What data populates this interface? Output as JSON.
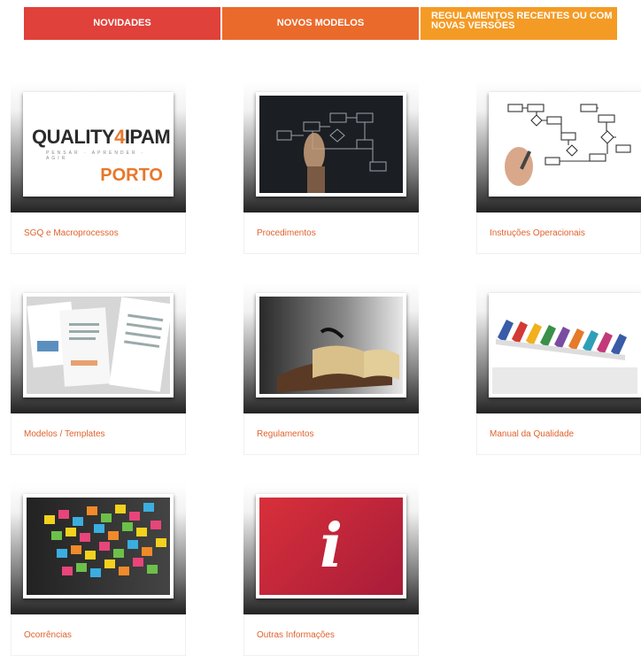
{
  "nav": {
    "tabs": [
      {
        "label": "NOVIDADES"
      },
      {
        "label": "NOVOS MODELOS"
      },
      {
        "label": "REGULAMENTOS RECENTES OU COM NOVAS VERSÕES"
      }
    ]
  },
  "cards": [
    {
      "label": "SGQ e Macroprocessos",
      "image_text": {
        "brand_left": "QUALITY",
        "brand_num": "4",
        "brand_right": "IPAM",
        "tagline": "PENSAR · APRENDER · AGIR",
        "city": "PORTO"
      }
    },
    {
      "label": "Procedimentos"
    },
    {
      "label": "Instruções Operacionais"
    },
    {
      "label": "Modelos / Templates"
    },
    {
      "label": "Regulamentos"
    },
    {
      "label": "Manual da Qualidade"
    },
    {
      "label": "Ocorrências"
    },
    {
      "label": "Outras Informações",
      "image_text": {
        "glyph": "i"
      }
    }
  ],
  "colors": {
    "tab1": "#e0413a",
    "tab2": "#ea6a2c",
    "tab3": "#f49b25",
    "caption": "#e0622c",
    "info_red": "#c8223a"
  }
}
